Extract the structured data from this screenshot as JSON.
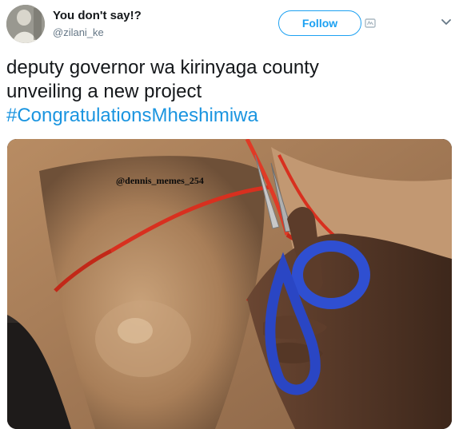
{
  "user": {
    "display_name": "You don't say!?",
    "handle": "@zilani_ke",
    "avatar_icon": "profile-avatar"
  },
  "actions": {
    "follow_label": "Follow",
    "follow_badge_icon": "follow-badge-icon",
    "menu_icon": "chevron-down-icon"
  },
  "tweet": {
    "text_line_1": "deputy governor wa kirinyaga county",
    "text_line_2": "unveiling a new project",
    "hashtag": "#CongratulationsMheshimiwa"
  },
  "media": {
    "watermark": "@dennis_memes_254"
  },
  "colors": {
    "accent": "#1da1f2",
    "hashtag": "#1b95e0",
    "text": "#14171a",
    "muted": "#657786"
  }
}
